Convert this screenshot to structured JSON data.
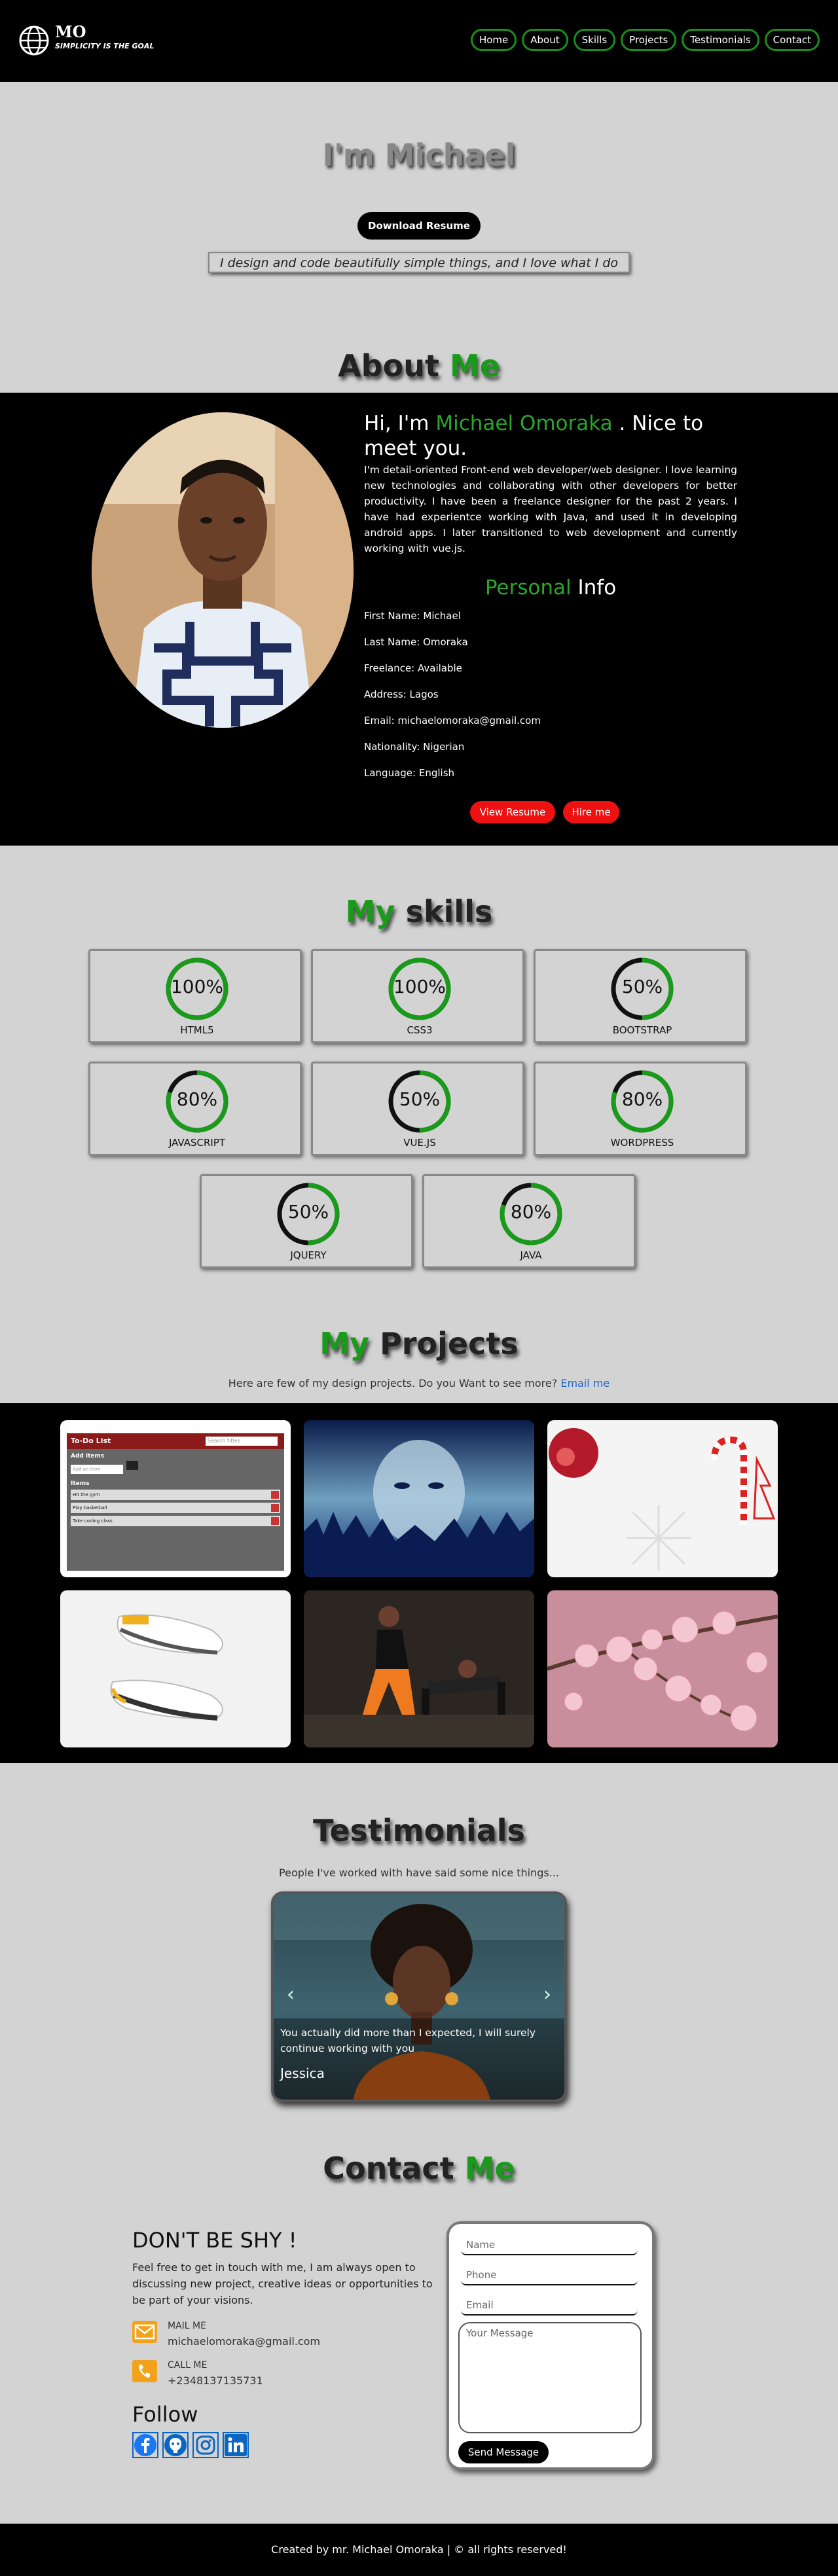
{
  "nav": {
    "logo_title": "MO",
    "logo_subtitle": "SIMPLICITY IS THE GOAL",
    "links": [
      "Home",
      "About",
      "Skills",
      "Projects",
      "Testimonials",
      "Contact"
    ]
  },
  "hero": {
    "title": "I'm Michael",
    "download_button": "Download Resume",
    "tagline": "I design and code beautifully simple things, and I love what I do"
  },
  "about": {
    "title_a": "About",
    "title_b": "Me",
    "greeting_a": "Hi, I'm",
    "greeting_name": "Michael Omoraka",
    "greeting_b": ". Nice to meet you.",
    "paragraph": "I'm detail-oriented Front-end web developer/web designer. I love learning new technologies and collaborating with other developers for better productivity. I have been a freelance designer for the past 2 years. I have had experientce working with Java, and used it in developing android apps. I later transitioned to web development and currently working with vue.js.",
    "info_title_a": "Personal",
    "info_title_b": "Info",
    "info": [
      "First Name: Michael",
      "Last Name: Omoraka",
      "Freelance: Available",
      "Address: Lagos",
      "Email: michaelomoraka@gmail.com",
      "Nationality: Nigerian",
      "Language: English"
    ],
    "view_resume": "View Resume",
    "hire_me": "Hire me"
  },
  "skills": {
    "title_a": "My",
    "title_b": "skills",
    "items": [
      {
        "name": "HTML5",
        "label": "100%",
        "value": 100
      },
      {
        "name": "CSS3",
        "label": "100%",
        "value": 100
      },
      {
        "name": "BOOTSTRAP",
        "label": "50%",
        "value": 50
      },
      {
        "name": "JAVASCRIPT",
        "label": "80%",
        "value": 80
      },
      {
        "name": "VUE.JS",
        "label": "50%",
        "value": 50
      },
      {
        "name": "WORDPRESS",
        "label": "80%",
        "value": 80
      },
      {
        "name": "JQUERY",
        "label": "50%",
        "value": 50
      },
      {
        "name": "JAVA",
        "label": "80%",
        "value": 80
      }
    ]
  },
  "projects": {
    "title_a": "My",
    "title_b": "Projects",
    "subtitle": "Here are few of my design projects. Do you Want to see more?",
    "email_link": "Email me",
    "todo": {
      "header": "To-Do List",
      "search": "Search titles",
      "add_label": "Add items",
      "add_placeholder": "Add an item",
      "items_label": "Items",
      "items": [
        "Hit the gym",
        "Play basketball",
        "Take coding class"
      ]
    }
  },
  "testimonials": {
    "title": "Testimonials",
    "subtitle": "People I've worked with have said some nice things...",
    "quote": "You actually did more than I expected, I will surely continue working with you",
    "name": "Jessica"
  },
  "contact": {
    "title_a": "Contact",
    "title_b": "Me",
    "heading": "DON'T BE SHY !",
    "paragraph": "Feel free to get in touch with me, I am always open to discussing new project, creative ideas or opportunities to be part of your visions.",
    "mail_label": "MAIL ME",
    "mail_value": "michaelomoraka@gmail.com",
    "call_label": "CALL ME",
    "call_value": "+2348137135731",
    "follow": "Follow",
    "form": {
      "name_placeholder": "Name",
      "phone_placeholder": "Phone",
      "email_placeholder": "Email",
      "message_placeholder": "Your Message",
      "send": "Send Message"
    }
  },
  "footer": "Created by mr. Michael Omoraka | © all rights reserved!",
  "colors": {
    "accent_green": "#1a9a1a",
    "red": "#ee1111",
    "orange": "#f2a31c",
    "link": "#2266cc"
  }
}
